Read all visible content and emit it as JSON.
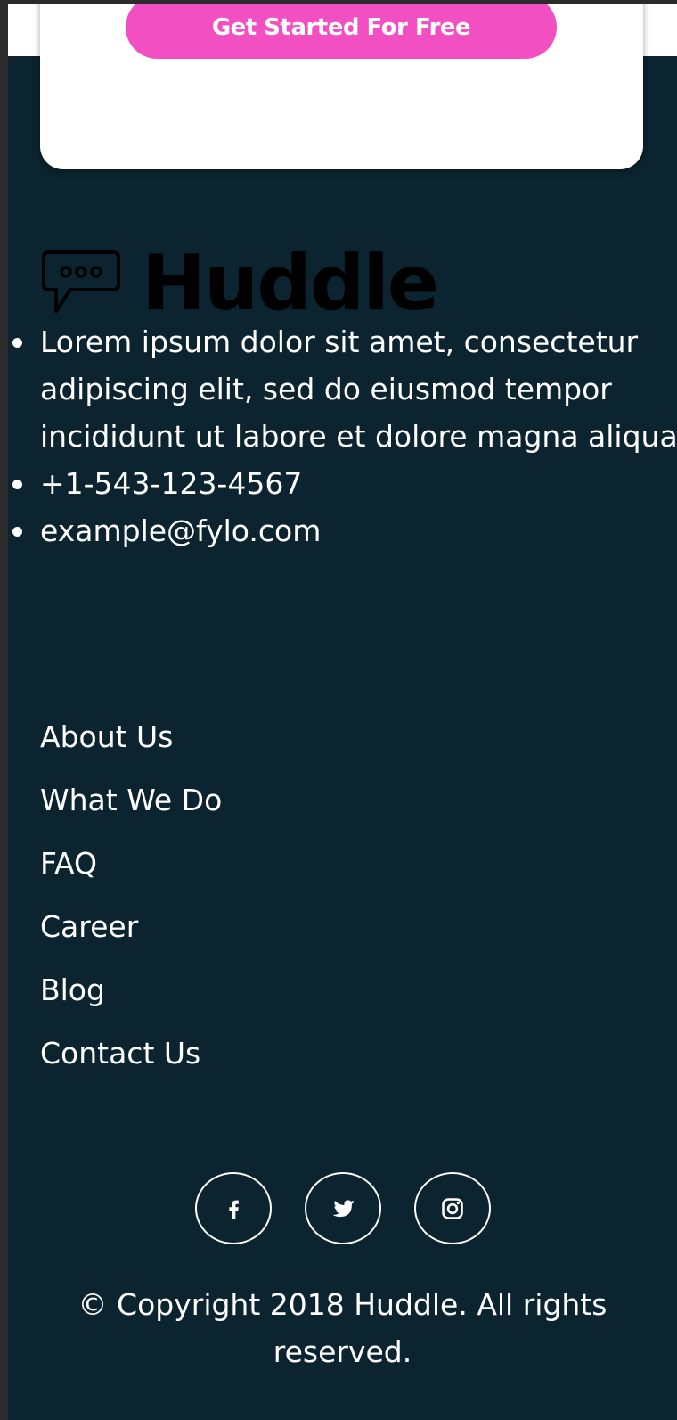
{
  "cta": {
    "button_label": "Get Started For Free"
  },
  "brand": {
    "logo_text": "Huddle",
    "logo_icon": "chat-bubble-icon"
  },
  "contact": {
    "description": "Lorem ipsum dolor sit amet, consectetur adipiscing elit, sed do eiusmod tempor incididunt ut labore et dolore magna aliqua",
    "phone": "+1-543-123-4567",
    "email": "example@fylo.com"
  },
  "nav": {
    "items": [
      {
        "label": "About Us"
      },
      {
        "label": "What We Do"
      },
      {
        "label": "FAQ"
      },
      {
        "label": "Career"
      },
      {
        "label": "Blog"
      },
      {
        "label": "Contact Us"
      }
    ]
  },
  "social": {
    "items": [
      {
        "icon": "facebook-icon"
      },
      {
        "icon": "twitter-icon"
      },
      {
        "icon": "instagram-icon"
      }
    ]
  },
  "footer": {
    "copyright_line1": "© Copyright 2018 Huddle. All rights",
    "copyright_line2": "reserved."
  },
  "colors": {
    "background": "#0b242f",
    "accent": "#f250c2",
    "text": "#ffffff"
  }
}
